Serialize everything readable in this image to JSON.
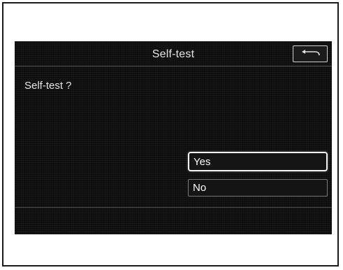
{
  "screen": {
    "title": "Self-test",
    "question": "Self-test ?",
    "back_button": {
      "icon": "back-arrow-icon"
    },
    "options": [
      {
        "label": "Yes",
        "selected": true
      },
      {
        "label": "No",
        "selected": false
      }
    ]
  }
}
